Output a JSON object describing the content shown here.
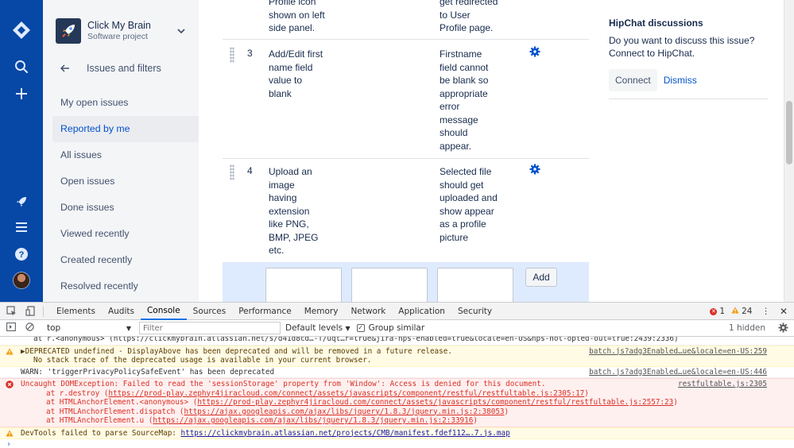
{
  "sidebar": {
    "project_name": "Click My Brain",
    "project_type": "Software project",
    "back_label": "Issues and filters",
    "items": [
      {
        "label": "My open issues",
        "active": false
      },
      {
        "label": "Reported by me",
        "active": true
      },
      {
        "label": "All issues",
        "active": false
      },
      {
        "label": "Open issues",
        "active": false
      },
      {
        "label": "Done issues",
        "active": false
      },
      {
        "label": "Viewed recently",
        "active": false
      },
      {
        "label": "Created recently",
        "active": false
      },
      {
        "label": "Resolved recently",
        "active": false
      }
    ]
  },
  "steps": {
    "partial": {
      "step": "Profile icon\nshown on left\nside panel.",
      "result": "get redirected\nto User\nProfile page."
    },
    "rows": [
      {
        "number": "3",
        "step": "Add/Edit first\nname field\nvalue to\nblank",
        "result": "Firstname\nfield cannot\nbe blank so\nappropriate\nerror\nmessage\nshould\nappear."
      },
      {
        "number": "4",
        "step": "Upload an\nimage\nhaving\nextension\nlike PNG,\nBMP, JPEG\netc.",
        "result": "Selected file\nshould get\nuploaded and\nshow appear\nas a profile\npicture"
      }
    ],
    "add_label": "Add"
  },
  "hipchat": {
    "title": "HipChat discussions",
    "text": "Do you want to discuss this issue? Connect to HipChat.",
    "connect_label": "Connect",
    "dismiss_label": "Dismiss"
  },
  "devtools": {
    "tabs": [
      "Elements",
      "Audits",
      "Console",
      "Sources",
      "Performance",
      "Memory",
      "Network",
      "Application",
      "Security"
    ],
    "active_tab": "Console",
    "error_count": "1",
    "warning_count": "24",
    "context": "top",
    "filter_placeholder": "Filter",
    "levels_label": "Default levels",
    "group_similar_label": "Group similar",
    "hidden_label": "1 hidden",
    "messages": [
      {
        "level": "log",
        "text": "at r.<anonymous> (https://clickmybrain.atlassian.net/s/d41d8cd…-T/uqt…r=true&jira-nps-enabled=true&locale=en-US&nps-not-opted-out=true:2439:2336)"
      },
      {
        "level": "warn",
        "text": "DEPRECATED undefined - DisplayAbove has been deprecated and will be removed in a future release.",
        "line2": "No stack trace of the deprecated usage is available in your current browser.",
        "source": "batch.js?adg3Enabled…ue&locale=en-US:259"
      },
      {
        "level": "log",
        "text": "WARN: 'triggerPrivacyPolicySafeEvent' has been deprecated",
        "source": "batch.js?adg3Enabled…ue&locale=en-US:446"
      },
      {
        "level": "error",
        "text": "Uncaught DOMException: Failed to read the 'sessionStorage' property from 'Window': Access is denied for this document.",
        "source": "restfultable.js:2305",
        "stack": [
          {
            "prefix": "at r.destroy (",
            "link": "https://prod-play.zephyr4jiracloud.com/connect/assets/javascripts/component/restful/restfultable.js:2305:17",
            "suffix": ")"
          },
          {
            "prefix": "at HTMLAnchorElement.<anonymous> (",
            "link": "https://prod-play.zephyr4jiracloud.com/connect/assets/javascripts/component/restful/restfultable.js:2557:23",
            "suffix": ")"
          },
          {
            "prefix": "at HTMLAnchorElement.dispatch (",
            "link": "https://ajax.googleapis.com/ajax/libs/jquery/1.8.3/jquery.min.js:2:38053",
            "suffix": ")"
          },
          {
            "prefix": "at HTMLAnchorElement.u (",
            "link": "https://ajax.googleapis.com/ajax/libs/jquery/1.8.3/jquery.min.js:2:33916",
            "suffix": ")"
          }
        ]
      },
      {
        "level": "warn",
        "text": "DevTools failed to parse SourceMap: ",
        "link": "https://clickmybrain.atlassian.net/projects/CMB/manifest.fdef112….7.js.map"
      }
    ]
  }
}
